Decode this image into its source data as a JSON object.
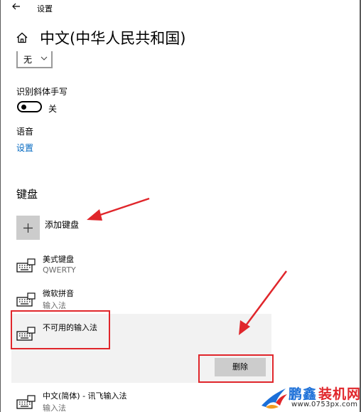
{
  "app": {
    "title": "设置"
  },
  "page": {
    "title": "中文(中华人民共和国)"
  },
  "handwriting_dropdown": {
    "value": "无"
  },
  "handwriting": {
    "label": "识别斜体手写",
    "toggle_state": "关"
  },
  "speech": {
    "label": "语音",
    "link": "设置"
  },
  "keyboards": {
    "heading": "键盘",
    "add_label": "添加键盘",
    "items": [
      {
        "name": "美式键盘",
        "subtitle": "QWERTY"
      },
      {
        "name": "微软拼音",
        "subtitle": "输入法"
      },
      {
        "name": "不可用的输入法",
        "subtitle": ""
      },
      {
        "name": "中文(简体) - 讯飞输入法",
        "subtitle": "输入法"
      }
    ],
    "remove_label": "删除"
  },
  "watermark": {
    "brand_a": "鹏鑫",
    "brand_b": "装机网",
    "url": "www.0753px.com"
  },
  "colors": {
    "accent": "#0067c0",
    "annotation": "#e0262b",
    "selected_bg": "#f2f2f2",
    "button_bg": "#cccccc"
  }
}
